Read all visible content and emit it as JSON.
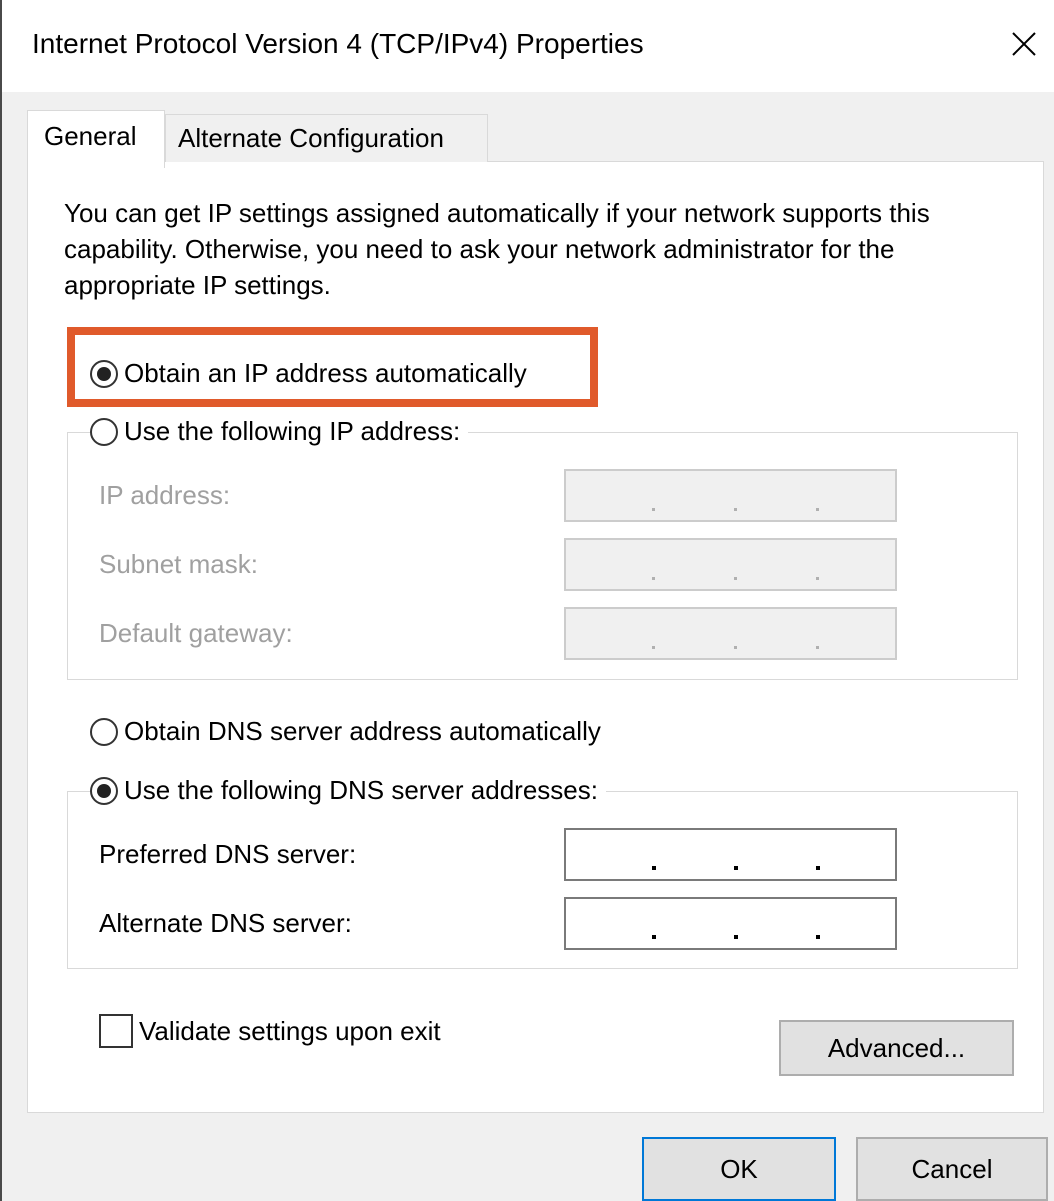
{
  "window": {
    "title": "Internet Protocol Version 4 (TCP/IPv4) Properties",
    "close_icon": "close-icon"
  },
  "tabs": [
    {
      "label": "General",
      "active": true
    },
    {
      "label": "Alternate Configuration",
      "active": false
    }
  ],
  "description": "You can get IP settings assigned automatically if your network supports this capability. Otherwise, you need to ask your network administrator for the appropriate IP settings.",
  "ip_section": {
    "auto_label": "Obtain an IP address automatically",
    "auto_selected": true,
    "manual_label": "Use the following IP address:",
    "manual_selected": false,
    "fields": [
      {
        "label": "IP address:",
        "value": ". . ."
      },
      {
        "label": "Subnet mask:",
        "value": ". . ."
      },
      {
        "label": "Default gateway:",
        "value": ". . ."
      }
    ]
  },
  "dns_section": {
    "auto_label": "Obtain DNS server address automatically",
    "auto_selected": false,
    "manual_label": "Use the following DNS server addresses:",
    "manual_selected": true,
    "fields": [
      {
        "label": "Preferred DNS server:",
        "value": ". . ."
      },
      {
        "label": "Alternate DNS server:",
        "value": ". . ."
      }
    ]
  },
  "validate_checkbox": {
    "label": "Validate settings upon exit",
    "checked": false
  },
  "buttons": {
    "advanced": "Advanced...",
    "ok": "OK",
    "cancel": "Cancel"
  },
  "colors": {
    "highlight": "#e05a2b",
    "ok_border": "#0078d7"
  }
}
